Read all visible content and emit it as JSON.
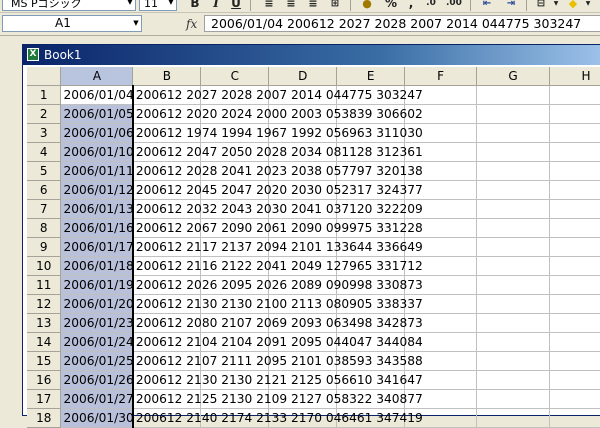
{
  "toolbar": {
    "font_name": "MS Pゴシック",
    "font_size": "11",
    "bold_label": "B",
    "italic_label": "I",
    "underline_label": "U",
    "percent_label": "%",
    "comma_label": ","
  },
  "formula_bar": {
    "name_box": "A1",
    "fx_label": "fx",
    "formula": "2006/01/04 200612 2027 2028 2007 2014 044775 303247"
  },
  "workbook": {
    "title": "Book1"
  },
  "columns": [
    "A",
    "B",
    "C",
    "D",
    "E",
    "F",
    "G",
    "H"
  ],
  "rows": [
    {
      "num": "1",
      "a": "2006/01/04",
      "rest": "200612 2027 2028 2007 2014 044775 303247"
    },
    {
      "num": "2",
      "a": "2006/01/05",
      "rest": "200612 2020 2024 2000 2003 053839 306602"
    },
    {
      "num": "3",
      "a": "2006/01/06",
      "rest": "200612 1974 1994 1967 1992 056963 311030"
    },
    {
      "num": "4",
      "a": "2006/01/10",
      "rest": "200612 2047 2050 2028 2034 081128 312361"
    },
    {
      "num": "5",
      "a": "2006/01/11",
      "rest": "200612 2028 2041 2023 2038 057797 320138"
    },
    {
      "num": "6",
      "a": "2006/01/12",
      "rest": "200612 2045 2047 2020 2030 052317 324377"
    },
    {
      "num": "7",
      "a": "2006/01/13",
      "rest": "200612 2032 2043 2030 2041 037120 322209"
    },
    {
      "num": "8",
      "a": "2006/01/16",
      "rest": "200612 2067 2090 2061 2090 099975 331228"
    },
    {
      "num": "9",
      "a": "2006/01/17",
      "rest": "200612 2117 2137 2094 2101 133644 336649"
    },
    {
      "num": "10",
      "a": "2006/01/18",
      "rest": "200612 2116 2122 2041 2049 127965 331712"
    },
    {
      "num": "11",
      "a": "2006/01/19",
      "rest": "200612 2026 2095 2026 2089 090998 330873"
    },
    {
      "num": "12",
      "a": "2006/01/20",
      "rest": "200612 2130 2130 2100 2113 080905 338337"
    },
    {
      "num": "13",
      "a": "2006/01/23",
      "rest": "200612 2080 2107 2069 2093 063498 342873"
    },
    {
      "num": "14",
      "a": "2006/01/24",
      "rest": "200612 2104 2104 2091 2095 044047 344084"
    },
    {
      "num": "15",
      "a": "2006/01/25",
      "rest": "200612 2107 2111 2095 2101 038593 343588"
    },
    {
      "num": "16",
      "a": "2006/01/26",
      "rest": "200612 2130 2130 2121 2125 056610 341647"
    },
    {
      "num": "17",
      "a": "2006/01/27",
      "rest": "200612 2125 2130 2109 2127 058322 340877"
    },
    {
      "num": "18",
      "a": "2006/01/30",
      "rest": "200612 2140 2174 2133 2170 046461 347419"
    }
  ]
}
